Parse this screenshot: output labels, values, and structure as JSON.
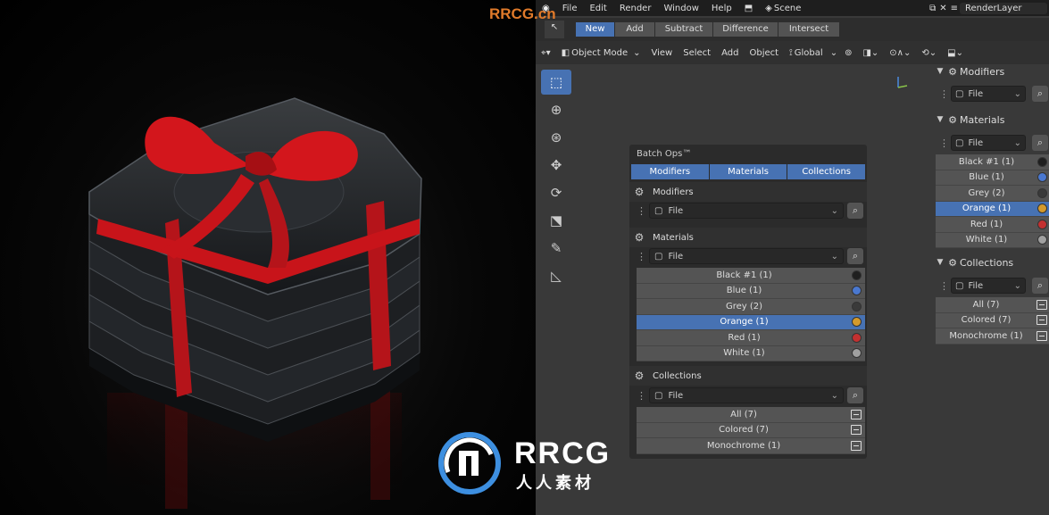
{
  "site_label": "RRCG.cn",
  "logo": {
    "main": "RRCG",
    "sub": "人人素材"
  },
  "menu": {
    "items": [
      "File",
      "Edit",
      "Render",
      "Window",
      "Help"
    ],
    "scene": "Scene",
    "render_layer": "RenderLayer"
  },
  "ops": {
    "new": "New",
    "add": "Add",
    "subtract": "Subtract",
    "difference": "Difference",
    "intersect": "Intersect"
  },
  "header": {
    "mode": "Object Mode",
    "view": "View",
    "select": "Select",
    "add": "Add",
    "object": "Object",
    "orientation": "Global"
  },
  "panel": {
    "title": "Batch Ops™",
    "tabs": [
      "Modifiers",
      "Materials",
      "Collections"
    ],
    "modifiers": {
      "label": "Modifiers",
      "file": "File"
    },
    "materials": {
      "label": "Materials",
      "file": "File",
      "items": [
        {
          "name": "Black #1 (1)",
          "color": "#1f1f1f",
          "selected": false
        },
        {
          "name": "Blue (1)",
          "color": "#4a78d0",
          "selected": false
        },
        {
          "name": "Grey (2)",
          "color": "#3a3a3a",
          "selected": false
        },
        {
          "name": "Orange (1)",
          "color": "#d49a2c",
          "selected": true
        },
        {
          "name": "Red (1)",
          "color": "#c33030",
          "selected": false
        },
        {
          "name": "White (1)",
          "color": "#a0a0a0",
          "selected": false
        }
      ]
    },
    "collections": {
      "label": "Collections",
      "file": "File",
      "items": [
        "All (7)",
        "Colored (7)",
        "Monochrome (1)"
      ]
    }
  },
  "sidebar": {
    "modifiers": {
      "label": "Modifiers",
      "file": "File"
    },
    "materials": {
      "label": "Materials",
      "file": "File"
    },
    "collections": {
      "label": "Collections",
      "file": "File"
    }
  },
  "colors": {
    "accent": "#4772b3",
    "bow": "#c8141a"
  }
}
